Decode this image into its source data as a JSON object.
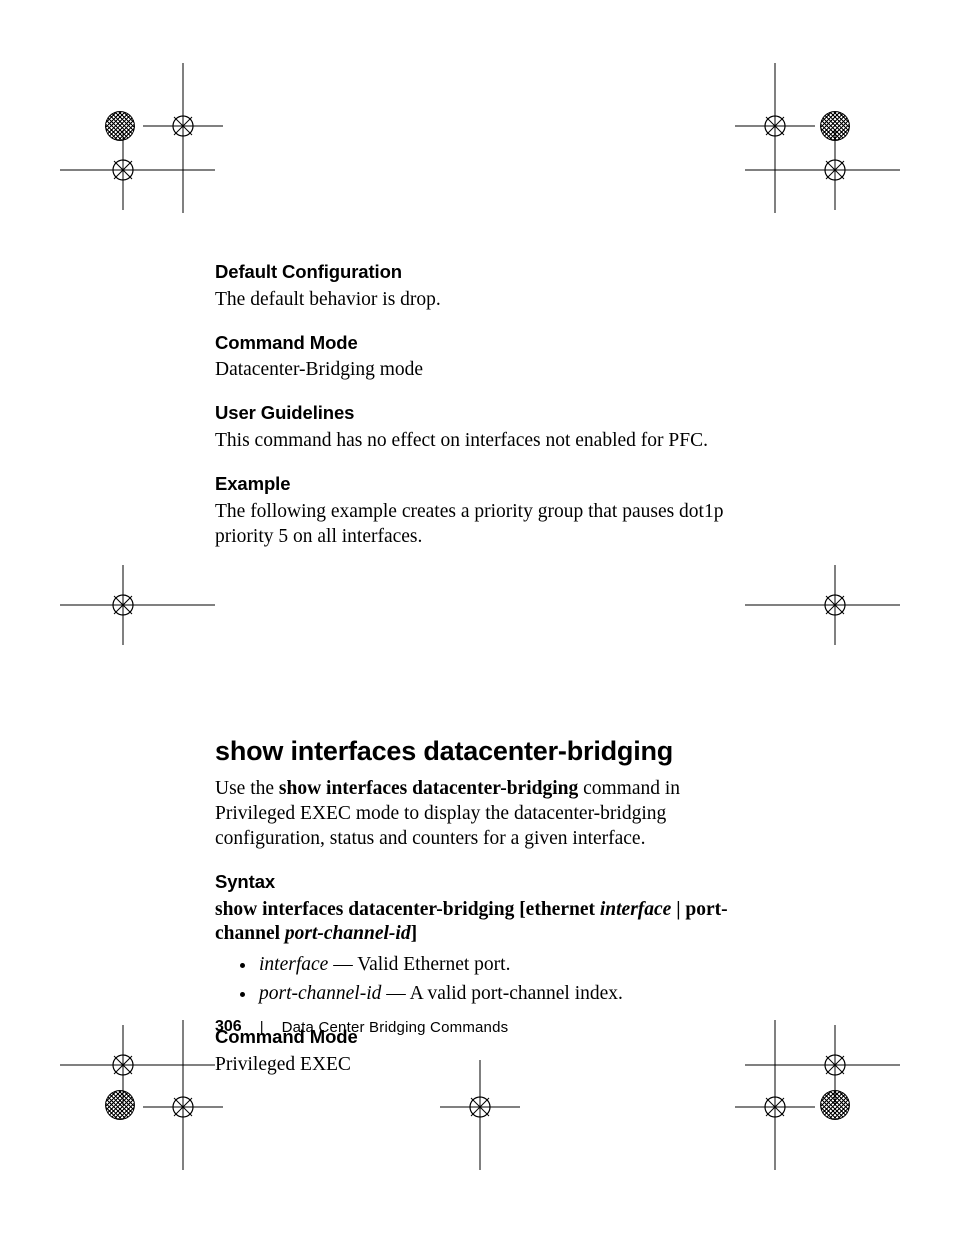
{
  "sections": {
    "default_config": {
      "heading": "Default Configuration",
      "body": "The default behavior is drop."
    },
    "command_mode_1": {
      "heading": "Command Mode",
      "body": "Datacenter-Bridging mode"
    },
    "user_guidelines": {
      "heading": "User Guidelines",
      "body": "This command has no effect on interfaces not enabled for PFC."
    },
    "example": {
      "heading": "Example",
      "body": "The following example creates a priority group that pauses dot1p priority 5 on all interfaces."
    },
    "command_title": "show interfaces datacenter-bridging",
    "command_intro": {
      "pre": "Use the ",
      "bold": "show interfaces datacenter-bridging",
      "post": " command in Privileged EXEC mode to display the datacenter-bridging configuration, status and counters for a given interface."
    },
    "syntax": {
      "heading": "Syntax",
      "line": {
        "p1": "show interfaces datacenter-bridging [ethernet ",
        "i1": "interface",
        "p2": " | port-channel ",
        "i2": "port-channel-id",
        "p3": "]"
      },
      "bullets": [
        {
          "term": "interface",
          "desc": " — Valid Ethernet port."
        },
        {
          "term": "port-channel-id",
          "desc": " — A valid port-channel  index."
        }
      ]
    },
    "command_mode_2": {
      "heading": "Command Mode",
      "body": "Privileged EXEC"
    }
  },
  "footer": {
    "page_number": "306",
    "separator": "|",
    "chapter": "Data Center Bridging Commands"
  }
}
